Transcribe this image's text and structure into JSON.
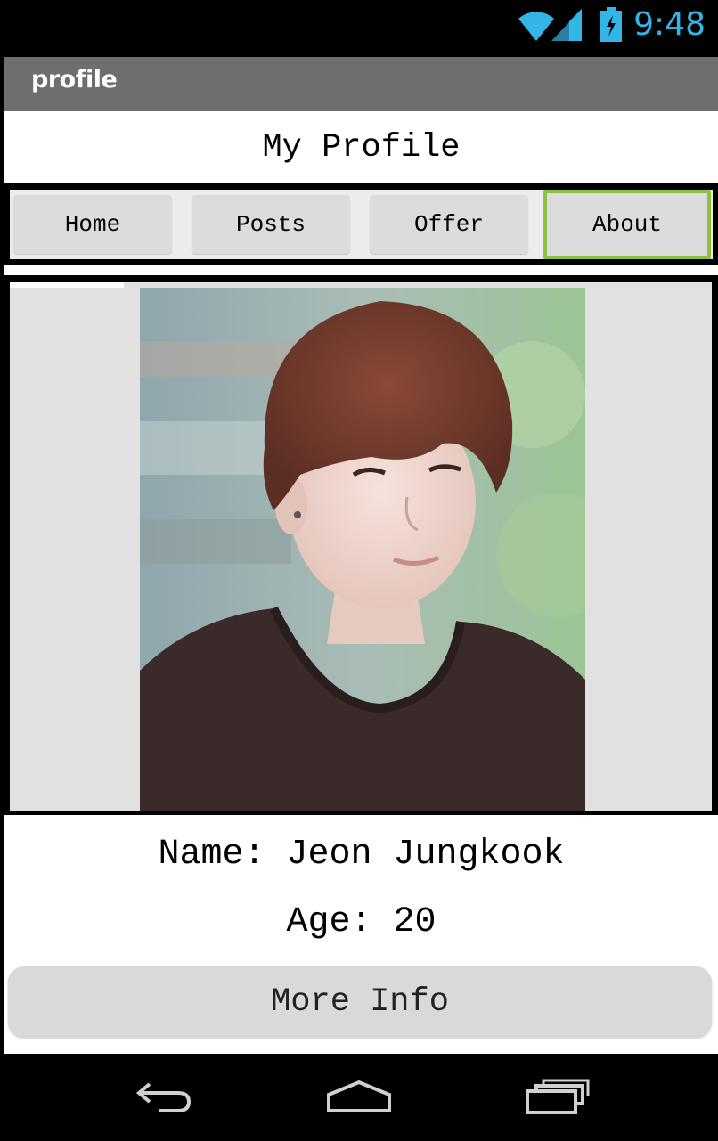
{
  "status_bar": {
    "time": "9:48",
    "icons": [
      "wifi-icon",
      "signal-icon",
      "battery-icon"
    ],
    "accent": "#33b5e5"
  },
  "action_bar": {
    "title": "profile"
  },
  "header": {
    "title": "My Profile"
  },
  "nav": {
    "items": [
      {
        "label": "Home",
        "active": false
      },
      {
        "label": "Posts",
        "active": false
      },
      {
        "label": "Offer",
        "active": false
      },
      {
        "label": "About",
        "active": true
      }
    ],
    "active_border_color": "#8fbf3e"
  },
  "profile": {
    "photo_icon": "profile-photo",
    "name": "Name: Jeon Jungkook",
    "age": "Age: 20",
    "more_button_label": "More Info"
  },
  "system_nav": {
    "icons": [
      "back-icon",
      "home-icon",
      "recent-apps-icon"
    ]
  }
}
